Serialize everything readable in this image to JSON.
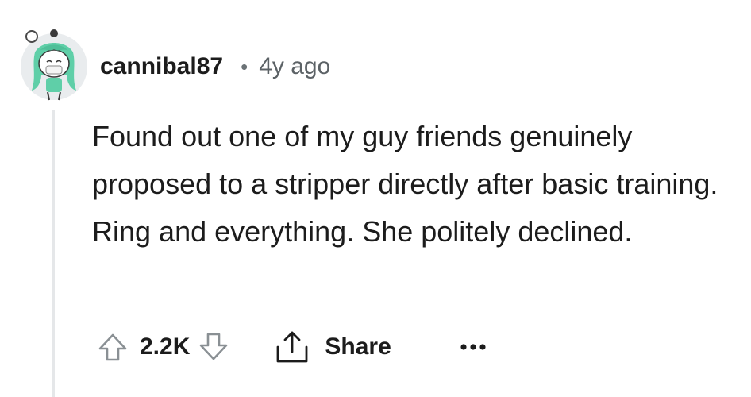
{
  "comment": {
    "author": "cannibal87",
    "separator": "•",
    "timestamp": "4y ago",
    "body": "Found out one of my guy friends genuinely proposed to a stripper directly after basic training. Ring and everything. She politely declined.",
    "score": "2.2K",
    "share_label": "Share"
  },
  "icons": {
    "avatar": "snoo-avatar-icon",
    "upvote": "arrow-up-icon",
    "downvote": "arrow-down-icon",
    "share": "share-icon",
    "more": "ellipsis-icon"
  },
  "colors": {
    "avatar_hair": "#5fcfa8",
    "avatar_bg": "#e9ecee",
    "thread_line": "#e5e7e9",
    "meta_text": "#5c6266",
    "icon_stroke": "#8a9094"
  }
}
